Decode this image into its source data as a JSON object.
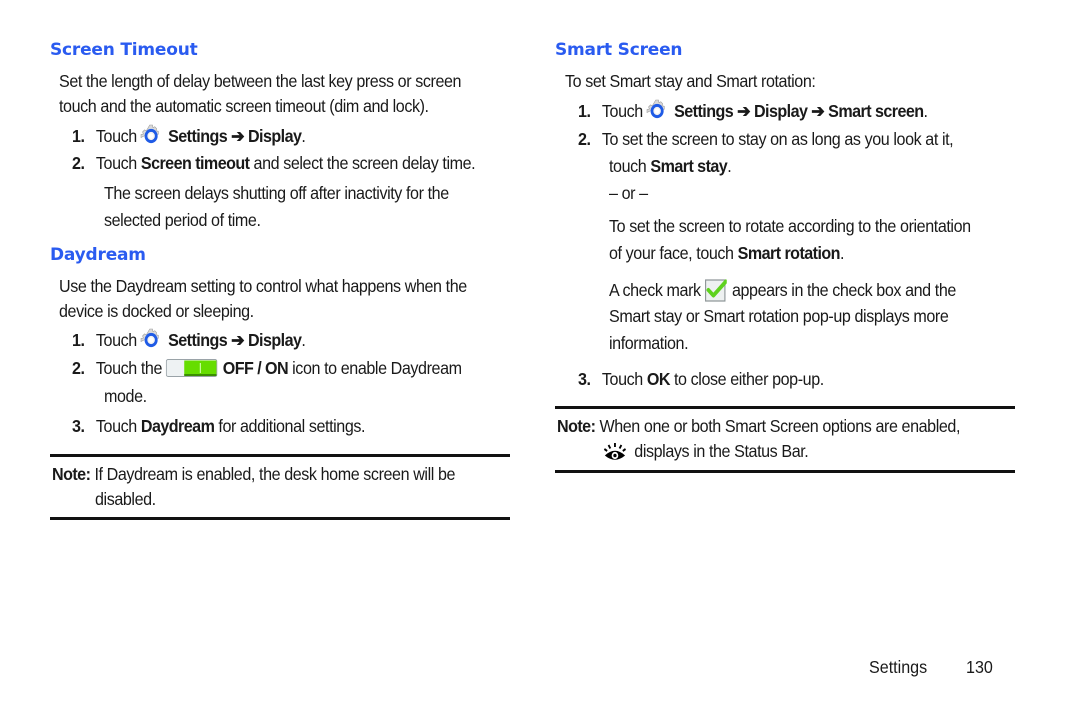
{
  "left": {
    "screen_timeout": {
      "heading": "Screen Timeout",
      "intro_line1": "Set the length of delay between the last key press or screen",
      "intro_line2": "touch and the automatic screen timeout (dim and lock).",
      "steps": [
        {
          "num": "1.",
          "pre": "Touch",
          "icon": "settings-gear-icon",
          "bold": "Settings ➔ Display",
          "post": "."
        },
        {
          "num": "2.",
          "pre": "Touch ",
          "bold": "Screen timeout",
          "post": " and select the screen delay time."
        }
      ],
      "step2_note_line1": "The screen delays shutting off after inactivity for the",
      "step2_note_line2": "selected period of time."
    },
    "daydream": {
      "heading": "Daydream",
      "intro_line1": "Use the Daydream setting to control what happens when the",
      "intro_line2": "device is docked or sleeping.",
      "steps": [
        {
          "num": "1.",
          "pre": "Touch",
          "icon": "settings-gear-icon",
          "bold": "Settings ➔ Display",
          "post": "."
        },
        {
          "num": "2.",
          "pre": "Touch the",
          "icon": "toggle-switch-icon",
          "bold": "OFF / ON",
          "post": " icon to enable Daydream",
          "line2": "mode."
        },
        {
          "num": "3.",
          "pre": "Touch ",
          "bold": "Daydream",
          "post": " for additional settings."
        }
      ]
    },
    "note": {
      "label": "Note:",
      "line1": " If Daydream is enabled, the desk home screen will be",
      "line2": "disabled."
    }
  },
  "right": {
    "smart_screen": {
      "heading": "Smart Screen",
      "intro": "To set Smart stay and Smart rotation:",
      "step1": {
        "num": "1.",
        "pre": "Touch",
        "icon": "settings-gear-icon",
        "bold": "Settings ➔ Display ➔ Smart screen",
        "post": "."
      },
      "step2": {
        "num": "2.",
        "line1": "To set the screen to stay on as long as you look at it,",
        "line2_pre": "touch ",
        "line2_bold": "Smart stay",
        "line2_post": ".",
        "or": "– or –",
        "rot_line1": "To set the screen to rotate according to the orientation",
        "rot_line2_pre": "of your face, touch ",
        "rot_line2_bold": "Smart rotation",
        "rot_line2_post": ".",
        "check_line1_pre": "A check mark",
        "check_icon": "check-mark-icon",
        "check_line1_post": "appears in the check box and the",
        "check_line2": "Smart stay or Smart rotation pop-up displays more",
        "check_line3": "information."
      },
      "step3": {
        "num": "3.",
        "pre": "Touch ",
        "bold": "OK",
        "post": " to close either pop-up."
      }
    },
    "note": {
      "label": "Note:",
      "line1": " When one or both Smart Screen options are enabled,",
      "icon": "smart-stay-eye-icon",
      "line2": "displays in the Status Bar."
    }
  },
  "footer": {
    "section": "Settings",
    "page_number": "130"
  },
  "colors": {
    "heading_blue": "#2a5bf0",
    "toggle_green": "#66dd00",
    "gear_blue": "#1f5be6"
  }
}
